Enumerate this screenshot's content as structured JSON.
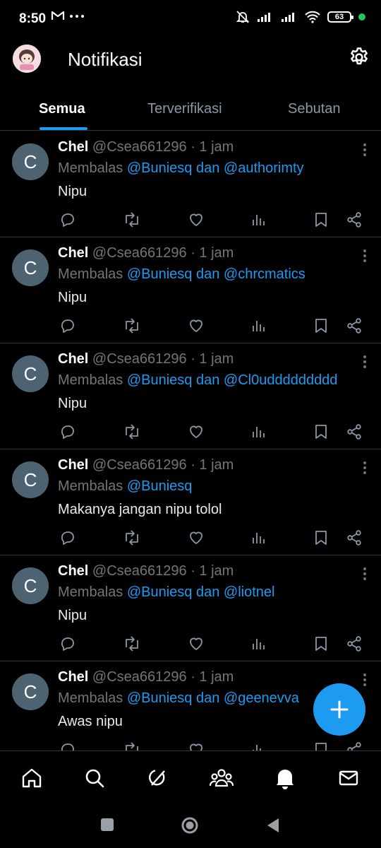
{
  "status_bar": {
    "time": "8:50",
    "battery": "63",
    "icons": [
      "gmail-icon",
      "more-dots-icon",
      "mute-icon",
      "signal-icon",
      "signal-icon",
      "wifi-icon",
      "battery-icon",
      "charging-dot-icon"
    ]
  },
  "header": {
    "title": "Notifikasi",
    "settings_icon": "gear-icon"
  },
  "tabs": [
    {
      "label": "Semua",
      "active": true
    },
    {
      "label": "Terverifikasi",
      "active": false
    },
    {
      "label": "Sebutan",
      "active": false
    }
  ],
  "tweets": [
    {
      "avatar_letter": "C",
      "name": "Chel",
      "handle": "@Csea661296",
      "time": "· 1 jam",
      "reply_prefix": "Membalas",
      "mentions": "@Buniesq dan @authorimty",
      "text": "Nipu"
    },
    {
      "avatar_letter": "C",
      "name": "Chel",
      "handle": "@Csea661296",
      "time": "· 1 jam",
      "reply_prefix": "Membalas",
      "mentions": "@Buniesq dan @chrcmatics",
      "text": "Nipu"
    },
    {
      "avatar_letter": "C",
      "name": "Chel",
      "handle": "@Csea661296",
      "time": "· 1 jam",
      "reply_prefix": "Membalas",
      "mentions": "@Buniesq dan @Cl0uddddddddd",
      "text": "Nipu"
    },
    {
      "avatar_letter": "C",
      "name": "Chel",
      "handle": "@Csea661296",
      "time": "· 1 jam",
      "reply_prefix": "Membalas",
      "mentions": "@Buniesq",
      "text": "Makanya jangan nipu tolol"
    },
    {
      "avatar_letter": "C",
      "name": "Chel",
      "handle": "@Csea661296",
      "time": "· 1 jam",
      "reply_prefix": "Membalas",
      "mentions": "@Buniesq dan @liotnel",
      "text": "Nipu"
    },
    {
      "avatar_letter": "C",
      "name": "Chel",
      "handle": "@Csea661296",
      "time": "· 1 jam",
      "reply_prefix": "Membalas",
      "mentions": "@Buniesq dan @geenevva",
      "text": "Awas nipu"
    }
  ],
  "tweet_actions": [
    "reply-icon",
    "retweet-icon",
    "like-icon",
    "views-icon",
    "bookmark-icon",
    "share-icon"
  ],
  "fab": {
    "icon": "plus-icon"
  },
  "bottom_nav": [
    "home-icon",
    "search-icon",
    "grok-icon",
    "communities-icon",
    "notifications-bell-icon",
    "messages-icon"
  ],
  "system_nav": [
    "recents-square-icon",
    "home-circle-icon",
    "back-triangle-icon"
  ],
  "colors": {
    "accent": "#1d9bf0",
    "background": "#000000",
    "muted_text": "#71767b",
    "divider": "#2f3336",
    "avatar_bg": "#4e6372"
  }
}
